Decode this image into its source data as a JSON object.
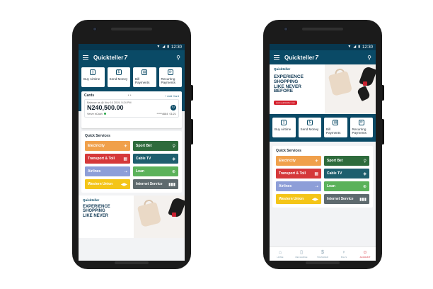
{
  "status_bar": {
    "time": "12:30"
  },
  "app": {
    "name": "Quickteller",
    "logo_mark": "7"
  },
  "actions": [
    {
      "icon": "phone-icon",
      "glyph": "▯",
      "label": "Buy Airtime"
    },
    {
      "icon": "money-icon",
      "glyph": "$",
      "label": "Send Money"
    },
    {
      "icon": "bill-icon",
      "glyph": "▤",
      "label": "Bill Payments"
    },
    {
      "icon": "recurring-icon",
      "glyph": "⟳",
      "label": "Recurring Payments"
    }
  ],
  "cards": {
    "title": "Cards",
    "pager": "• •",
    "add_label": "+ Add Card",
    "balance_as_at": "Balance as @ Nov 16 2019, 5:24 PM",
    "balance": "N240,500.00",
    "card_name": "Verve eCash",
    "card_number": "*****4684",
    "expiry": "01/21"
  },
  "quick_services": {
    "title": "Quick Services",
    "tiles": [
      {
        "label": "Electricity",
        "glyph": "✈",
        "color": "#f0a04b"
      },
      {
        "label": "Sport Bet",
        "glyph": "⚲",
        "color": "#2e6b3c"
      },
      {
        "label": "Transport & Toll",
        "glyph": "▦",
        "color": "#d5383a"
      },
      {
        "label": "Cable TV",
        "glyph": "◈",
        "color": "#1e5f6e"
      },
      {
        "label": "Airlines",
        "glyph": "➝",
        "color": "#8d9ed8"
      },
      {
        "label": "Loan",
        "glyph": "⊕",
        "color": "#5bb25a"
      },
      {
        "label": "Western Union",
        "glyph": "◀▶",
        "color": "#f4c518"
      },
      {
        "label": "Internet Service",
        "glyph": "▮▮▮",
        "color": "#5e6a6e"
      }
    ]
  },
  "promo": {
    "logo": "Quickteller",
    "headline": [
      "EXPERIENCE",
      "SHOPPING",
      "LIKE NEVER",
      "BEFORE"
    ],
    "cta": "www.quickteller.com"
  },
  "tabs": [
    {
      "label": "Home",
      "glyph": "⌂"
    },
    {
      "label": "Recharge",
      "glyph": "▯"
    },
    {
      "label": "Transfer",
      "glyph": "$"
    },
    {
      "label": "Bills",
      "glyph": "♀"
    },
    {
      "label": "Account",
      "glyph": "☺"
    }
  ]
}
